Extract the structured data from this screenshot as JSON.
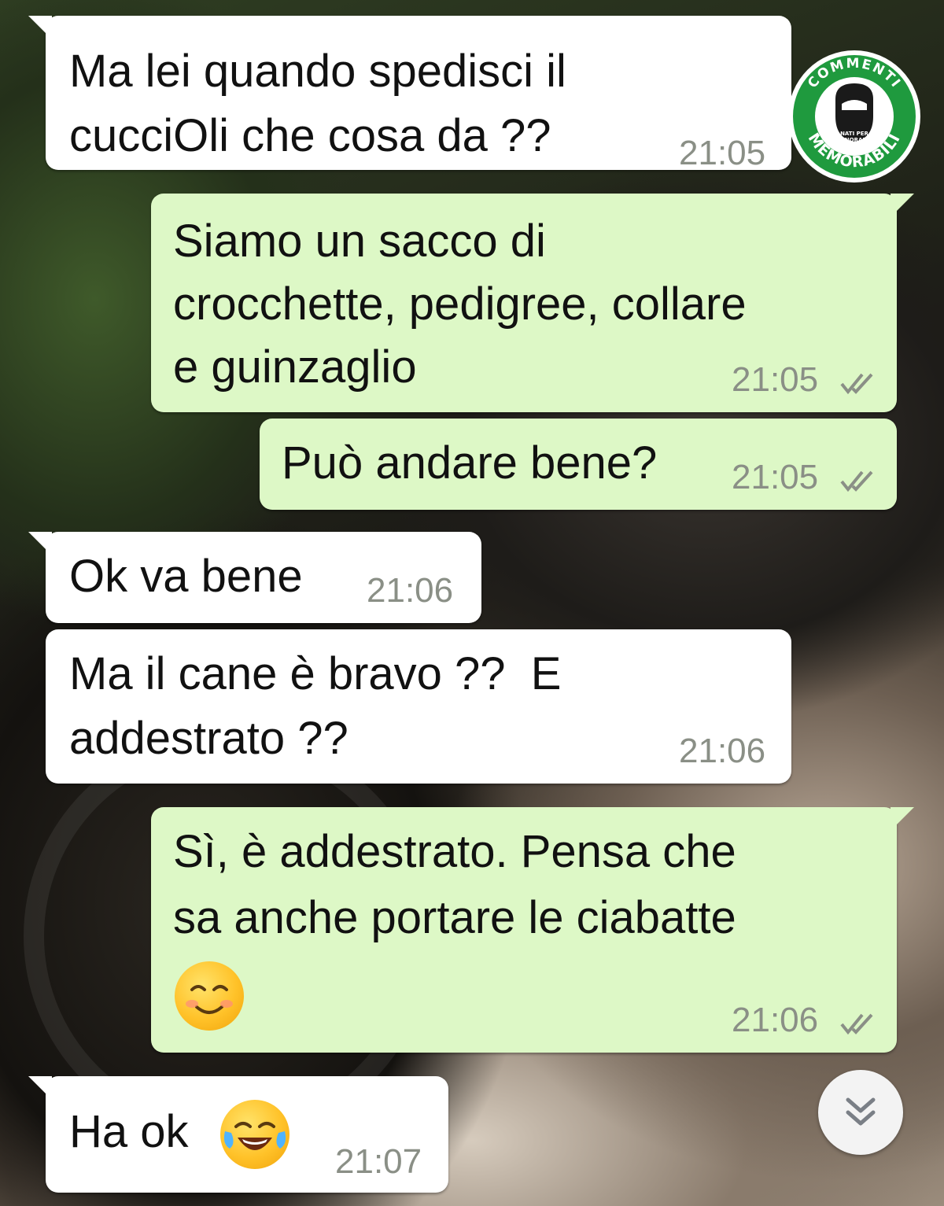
{
  "watermark": {
    "brand_top": "COMMENTI",
    "brand_bottom": "MEMORABILI",
    "tagline_line1": "NATI PER",
    "tagline_line2": "IGNORARE"
  },
  "messages": [
    {
      "direction": "incoming",
      "lines": [
        "Ma lei quando spedisci il",
        "cucciOli che cosa da ??"
      ],
      "time": "21:05"
    },
    {
      "direction": "outgoing",
      "lines": [
        "Siamo un sacco di",
        "crocchette, pedigree, collare",
        "e guinzaglio"
      ],
      "time": "21:05",
      "status": "read"
    },
    {
      "direction": "outgoing",
      "lines": [
        "Può andare bene?"
      ],
      "time": "21:05",
      "status": "read"
    },
    {
      "direction": "incoming",
      "lines": [
        "Ok va bene"
      ],
      "time": "21:06"
    },
    {
      "direction": "incoming",
      "lines": [
        "Ma il cane è bravo ??  E",
        "addestrato ??"
      ],
      "time": "21:06"
    },
    {
      "direction": "outgoing",
      "lines": [
        "Sì, è addestrato. Pensa che",
        "sa anche portare le ciabatte"
      ],
      "emoji": "smiling-face-emoji",
      "time": "21:06",
      "status": "read"
    },
    {
      "direction": "incoming",
      "lines": [
        "Ha ok"
      ],
      "emoji": "tears-of-joy-emoji",
      "time": "21:07"
    }
  ],
  "icons": {
    "read_receipt": "double-check-icon",
    "scroll_down": "double-chevron-down-icon"
  },
  "colors": {
    "incoming_bubble": "#ffffff",
    "outgoing_bubble": "#ddf8c6",
    "timestamp": "#8a8f86",
    "badge_green": "#1f9a3e"
  }
}
